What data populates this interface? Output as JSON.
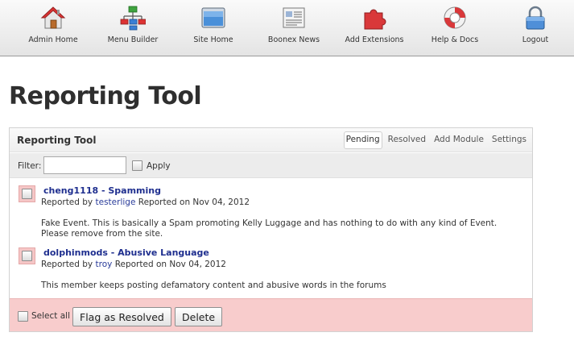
{
  "toolbar": {
    "items": [
      {
        "label": "Admin Home",
        "icon": "home-icon"
      },
      {
        "label": "Menu Builder",
        "icon": "sitemap-icon"
      },
      {
        "label": "Site Home",
        "icon": "browser-window-icon"
      },
      {
        "label": "Boonex News",
        "icon": "news-icon"
      },
      {
        "label": "Add Extensions",
        "icon": "puzzle-icon"
      },
      {
        "label": "Help & Docs",
        "icon": "lifebuoy-icon"
      },
      {
        "label": "Logout",
        "icon": "lock-icon"
      }
    ]
  },
  "page": {
    "title": "Reporting Tool"
  },
  "panel": {
    "title": "Reporting Tool",
    "tabs": [
      "Pending",
      "Resolved",
      "Add Module",
      "Settings"
    ],
    "active_tab": "Pending",
    "filter": {
      "label": "Filter:",
      "value": "",
      "apply_label": "Apply"
    }
  },
  "reports": [
    {
      "title": "cheng1118 - Spamming",
      "reported_by_prefix": "Reported by",
      "reporter": "testerlige",
      "reported_on": "Reported on Nov 04, 2012",
      "description": "Fake Event. This is basically a Spam promoting Kelly Luggage and has nothing to do with any kind of Event. Please remove from the site."
    },
    {
      "title": "dolphinmods - Abusive Language",
      "reported_by_prefix": "Reported by",
      "reporter": "troy",
      "reported_on": "Reported on Nov 04, 2012",
      "description": "This member keeps posting defamatory content and abusive words in the forums"
    }
  ],
  "footer": {
    "select_all_label": "Select all",
    "flag_button": "Flag as Resolved",
    "delete_button": "Delete"
  },
  "colors": {
    "link": "#1f2f8f",
    "footer_bg": "#f8cccc",
    "checkbox_highlight": "#f5c6c6"
  }
}
